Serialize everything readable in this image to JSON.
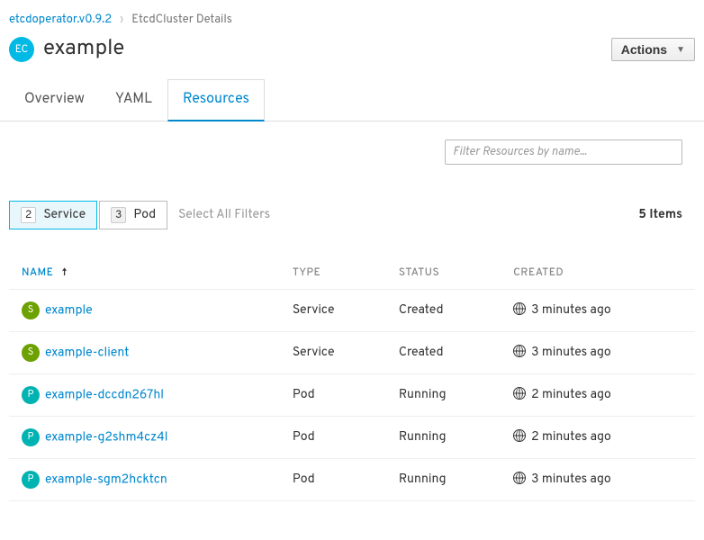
{
  "breadcrumb": {
    "parent": "etcdoperator.v0.9.2",
    "current": "EtcdCluster Details"
  },
  "header": {
    "badge": "EC",
    "title": "example",
    "actions_label": "Actions"
  },
  "tabs": [
    {
      "label": "Overview",
      "active": false
    },
    {
      "label": "YAML",
      "active": false
    },
    {
      "label": "Resources",
      "active": true
    }
  ],
  "filter": {
    "placeholder": "Filter Resources by name..."
  },
  "chips": [
    {
      "count": "2",
      "label": "Service",
      "active": true
    },
    {
      "count": "3",
      "label": "Pod",
      "active": false
    }
  ],
  "select_all_label": "Select All Filters",
  "item_count_label": "5 Items",
  "columns": {
    "name": "NAME",
    "type": "TYPE",
    "status": "STATUS",
    "created": "CREATED"
  },
  "rows": [
    {
      "badge": "S",
      "name": "example",
      "type": "Service",
      "status": "Created",
      "created": "3 minutes ago"
    },
    {
      "badge": "S",
      "name": "example-client",
      "type": "Service",
      "status": "Created",
      "created": "3 minutes ago"
    },
    {
      "badge": "P",
      "name": "example-dccdn267hl",
      "type": "Pod",
      "status": "Running",
      "created": "2 minutes ago"
    },
    {
      "badge": "P",
      "name": "example-g2shm4cz4l",
      "type": "Pod",
      "status": "Running",
      "created": "2 minutes ago"
    },
    {
      "badge": "P",
      "name": "example-sgm2hcktcn",
      "type": "Pod",
      "status": "Running",
      "created": "3 minutes ago"
    }
  ]
}
